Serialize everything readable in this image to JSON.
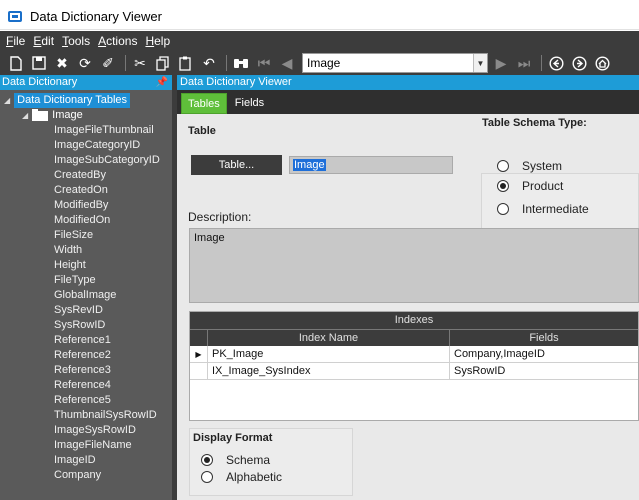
{
  "window": {
    "title": "Data Dictionary Viewer"
  },
  "menu": [
    {
      "label": "File",
      "key": "F",
      "rest": "ile"
    },
    {
      "label": "Edit",
      "key": "E",
      "rest": "dit"
    },
    {
      "label": "Tools",
      "key": "T",
      "rest": "ools"
    },
    {
      "label": "Actions",
      "key": "A",
      "rest": "ctions"
    },
    {
      "label": "Help",
      "key": "H",
      "rest": "elp"
    }
  ],
  "toolbar": {
    "table_selector": {
      "value": "Image"
    },
    "icons": [
      "new-icon",
      "save-icon",
      "delete-icon",
      "refresh-icon",
      "clear-icon",
      "cut-icon",
      "copy-icon",
      "paste-icon",
      "undo-icon",
      "find-icon",
      "first-record-icon",
      "previous-record-icon",
      "next-record-icon",
      "last-record-icon",
      "back-icon",
      "forward-icon",
      "home-icon"
    ]
  },
  "left_panel": {
    "title": "Data Dictionary",
    "root_label": "Data Dictionary Tables",
    "table_label": "Image",
    "fields": [
      "ImageFileThumbnail",
      "ImageCategoryID",
      "ImageSubCategoryID",
      "CreatedBy",
      "CreatedOn",
      "ModifiedBy",
      "ModifiedOn",
      "FileSize",
      "Width",
      "Height",
      "FileType",
      "GlobalImage",
      "SysRevID",
      "SysRowID",
      "Reference1",
      "Reference2",
      "Reference3",
      "Reference4",
      "Reference5",
      "ThumbnailSysRowID",
      "ImageSysRowID",
      "ImageFileName",
      "ImageID",
      "Company"
    ]
  },
  "right_panel": {
    "title": "Data Dictionary Viewer",
    "tabs": [
      {
        "label": "Tables",
        "active": true
      },
      {
        "label": "Fields",
        "active": false
      }
    ],
    "table_section": {
      "title": "Table",
      "table_button": "Table...",
      "table_name": "Image",
      "description_label": "Description:",
      "description": "Image"
    },
    "schema_type": {
      "title": "Table Schema Type:",
      "options": [
        "System",
        "Product",
        "Intermediate"
      ],
      "selected": "Product"
    },
    "indexes": {
      "caption": "Indexes",
      "columns": [
        "Index Name",
        "Fields"
      ],
      "rows": [
        {
          "name": "PK_Image",
          "fields": "Company,ImageID",
          "current": true
        },
        {
          "name": "IX_Image_SysIndex",
          "fields": "SysRowID",
          "current": false
        }
      ]
    },
    "display_format": {
      "title": "Display Format",
      "options": [
        "Schema",
        "Alphabetic"
      ],
      "selected": "Schema"
    }
  },
  "colors": {
    "accent_blue": "#1e9cd7",
    "active_tab_green": "#5fbf3a",
    "dark_chrome": "#3c3c3c"
  }
}
